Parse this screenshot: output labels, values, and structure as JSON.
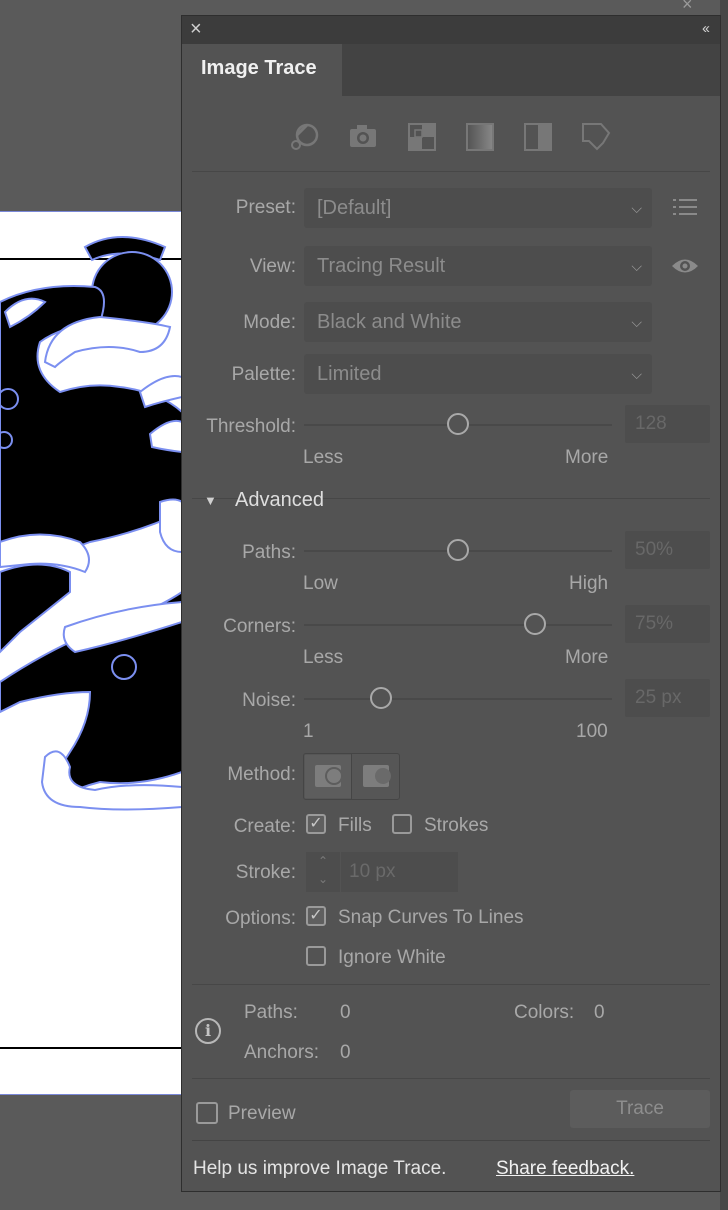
{
  "panel": {
    "title": "Image Trace",
    "tool_icons": [
      "auto-color-icon",
      "high-color-icon",
      "low-color-icon",
      "grayscale-icon",
      "black-and-white-icon",
      "outline-icon"
    ]
  },
  "preset": {
    "label": "Preset:",
    "value": "[Default]",
    "menu_icon": "preset-list-icon"
  },
  "view": {
    "label": "View:",
    "value": "Tracing Result",
    "eye_icon": "eye-icon"
  },
  "mode": {
    "label": "Mode:",
    "value": "Black and White"
  },
  "palette": {
    "label": "Palette:",
    "value": "Limited"
  },
  "threshold": {
    "label": "Threshold:",
    "value": "128",
    "level": 0.5,
    "min_label": "Less",
    "max_label": "More"
  },
  "advanced": {
    "label": "Advanced",
    "paths": {
      "label": "Paths:",
      "value": "50%",
      "level": 0.5,
      "min_label": "Low",
      "max_label": "High"
    },
    "corners": {
      "label": "Corners:",
      "value": "75%",
      "level": 0.75,
      "min_label": "Less",
      "max_label": "More"
    },
    "noise": {
      "label": "Noise:",
      "value": "25 px",
      "level": 0.25,
      "min_label": "1",
      "max_label": "100"
    },
    "method": {
      "label": "Method:",
      "options": [
        "abutting-icon",
        "overlapping-icon"
      ]
    },
    "create": {
      "label": "Create:",
      "fills": "Fills",
      "fills_checked": true,
      "strokes": "Strokes",
      "strokes_checked": false
    },
    "stroke": {
      "label": "Stroke:",
      "value": "10 px"
    },
    "options": {
      "label": "Options:",
      "snap": "Snap Curves To Lines",
      "snap_checked": true,
      "ignore_white": "Ignore White",
      "ignore_white_checked": false
    }
  },
  "stats": {
    "paths_label": "Paths:",
    "paths": "0",
    "colors_label": "Colors:",
    "colors": "0",
    "anchors_label": "Anchors:",
    "anchors": "0"
  },
  "footer": {
    "preview": "Preview",
    "preview_checked": false,
    "trace_button": "Trace",
    "help_text": "Help us improve Image Trace.",
    "feedback_link": "Share feedback."
  },
  "colors": {
    "panel_bg": "#535353",
    "artwork_outline": "#7b8ff0",
    "artboard": "#ffffff"
  }
}
